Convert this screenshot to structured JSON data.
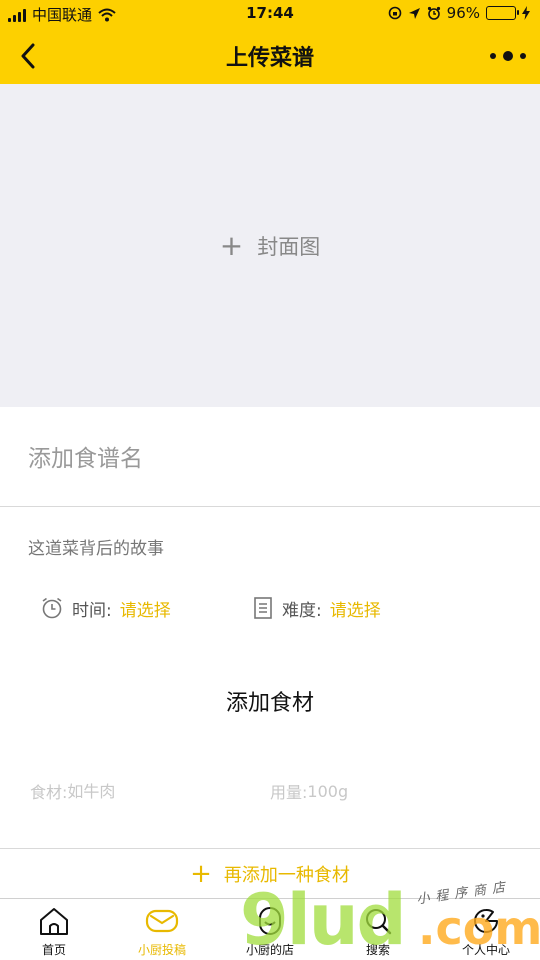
{
  "status_bar": {
    "carrier": "中国联通",
    "time": "17:44",
    "battery_percent": "96%",
    "battery_level": 0.96
  },
  "nav": {
    "title": "上传菜谱"
  },
  "cover": {
    "plus": "+",
    "label": "封面图"
  },
  "form": {
    "name_placeholder": "添加食谱名",
    "story_placeholder": "这道菜背后的故事",
    "time_label": "时间:",
    "time_value": "请选择",
    "level_label": "难度:",
    "level_value": "请选择"
  },
  "ingredients": {
    "title": "添加食材",
    "name_label": "食材:",
    "name_placeholder": "如牛肉",
    "qty_label": "用量:",
    "qty_placeholder": "100g",
    "add_more_plus": "+",
    "add_more_label": "再添加一种食材"
  },
  "tabbar": {
    "tabs": [
      {
        "label": "首页",
        "icon": "home-icon",
        "active": false
      },
      {
        "label": "小厨投稿",
        "icon": "envelope-icon",
        "active": true
      },
      {
        "label": "小厨的店",
        "icon": "store-icon",
        "active": false
      },
      {
        "label": "搜索",
        "icon": "search-icon",
        "active": false
      },
      {
        "label": "个人中心",
        "icon": "profile-icon",
        "active": false
      }
    ]
  },
  "watermark": {
    "brand": "9lud",
    "domain": ".com",
    "tagline": "小程序商店"
  },
  "colors": {
    "brand_yellow": "#FDD000",
    "accent_gold": "#E8B900",
    "cover_bg": "#EFEFF4"
  }
}
